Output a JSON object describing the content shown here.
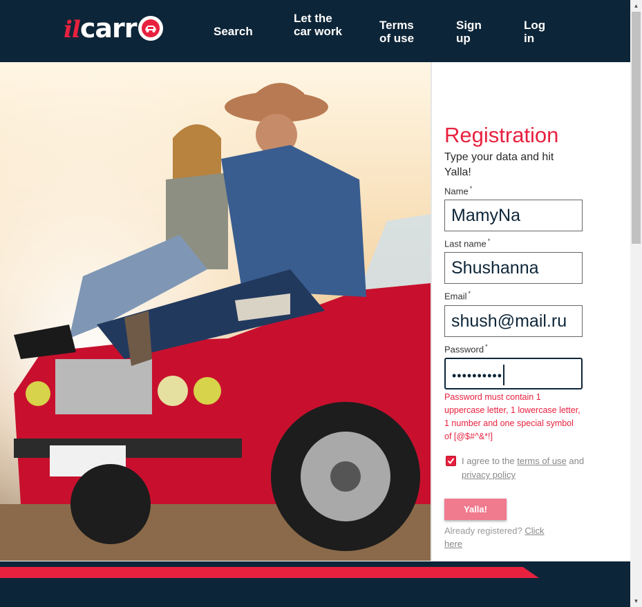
{
  "header": {
    "logo": {
      "il": "il",
      "carr": "carr"
    },
    "nav": {
      "search": "Search",
      "let_car_work": "Let the car work",
      "terms": "Terms of use",
      "signup": "Sign up",
      "login": "Log in"
    }
  },
  "form": {
    "title": "Registration",
    "subtitle": "Type your data and hit Yalla!",
    "name_label": "Name",
    "name_value": "MamyNa",
    "lastname_label": "Last name",
    "lastname_value": "Shushanna",
    "email_label": "Email",
    "email_value": "shush@mail.ru",
    "password_label": "Password",
    "password_masked": "••••••••••",
    "required_mark": "*",
    "password_error": "Password must contain 1 uppercase letter, 1 lowercase letter, 1 number and one special symbol of [@$#^&*!]",
    "agree_prefix": "I agree to the",
    "terms_link": "terms of use",
    "agree_and": "and",
    "privacy_link": "privacy policy",
    "submit_label": "Yalla!",
    "already_text": "Already registered?",
    "click_here": "Click here"
  },
  "colors": {
    "navy": "#0d2538",
    "accent": "#e8213f",
    "button": "#f07a8e"
  },
  "icons": {
    "logo_car": "car-icon",
    "checkbox": "checkmark-icon"
  }
}
